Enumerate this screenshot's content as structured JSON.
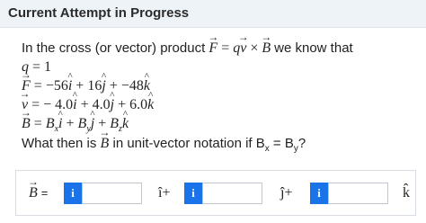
{
  "header": {
    "title": "Current Attempt in Progress"
  },
  "question": {
    "intro": "In the cross (or vector) product",
    "formula_F": "F",
    "formula_eq": "=",
    "formula_q": "q",
    "formula_v": "v",
    "formula_cross": "×",
    "formula_B": "B",
    "intro_tail": "we know that",
    "q_label": "q",
    "q_eq": "=",
    "q_value": "1",
    "F_label": "F",
    "F_eq": "=",
    "F_x": "−56",
    "F_i": "i",
    "F_plus1": "+",
    "F_y": "16",
    "F_j": "j",
    "F_plus2": "+",
    "F_z": "−48",
    "F_k": "k",
    "v_label": "v",
    "v_eq": "=",
    "v_x": "− 4.0",
    "v_i": "i",
    "v_plus1": "+",
    "v_y": "4.0",
    "v_j": "j",
    "v_plus2": "+",
    "v_z": "6.0",
    "v_k": "k",
    "B_label": "B",
    "B_eq": "=",
    "B_x": "B",
    "B_x_sub": "x",
    "B_i": "i",
    "B_plus1": "+",
    "B_y": "B",
    "B_y_sub": "y",
    "B_j": "j",
    "B_plus2": "+",
    "B_z": "B",
    "B_z_sub": "z",
    "B_k": "k",
    "ask_prefix": "What then is",
    "ask_B": "B",
    "ask_middle": "in unit-vector notation if B",
    "ask_sub_x": "x",
    "ask_eq": " = B",
    "ask_sub_y": "y",
    "ask_end": "?"
  },
  "answer": {
    "B_label": "B",
    "eq": "=",
    "info_label": "i",
    "unit_i": "î+",
    "unit_j": "ĵ+",
    "unit_k": "k̂",
    "input1_value": "",
    "input2_value": "",
    "input3_value": ""
  },
  "colors": {
    "header_bg": "#eef3f8",
    "info_btn": "#1a73e8"
  },
  "icons": {
    "info": "info-icon"
  }
}
